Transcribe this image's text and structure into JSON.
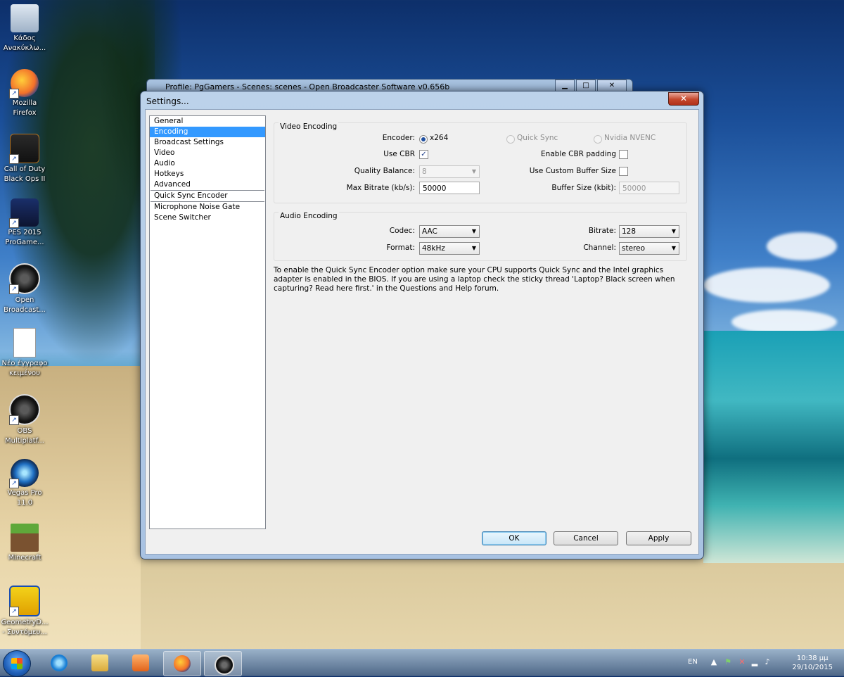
{
  "desktop": {
    "icons": [
      {
        "label": "Κάδος Ανακύκλω...",
        "icon": "recycle-bin-icon"
      },
      {
        "label": "Mozilla Firefox",
        "icon": "firefox-icon"
      },
      {
        "label": "Call of Duty Black Ops II",
        "icon": "game-icon"
      },
      {
        "label": "PES 2015 ProGame...",
        "icon": "game-icon"
      },
      {
        "label": "Open Broadcast...",
        "icon": "obs-icon"
      },
      {
        "label": "Νέο έγγραφο κειμένου",
        "icon": "text-file-icon"
      },
      {
        "label": "OBS Multiplatf...",
        "icon": "obs-icon"
      },
      {
        "label": "Vegas Pro 11.0",
        "icon": "vegas-icon"
      },
      {
        "label": "Minecraft",
        "icon": "minecraft-icon"
      },
      {
        "label": "GeometryD... - Συντόμευ...",
        "icon": "game-icon"
      }
    ]
  },
  "background_window": {
    "title": "Profile: PgGamers - Scenes: scenes - Open Broadcaster Software v0.656b",
    "min": "▁",
    "max": "□",
    "close": "✕"
  },
  "dialog": {
    "title": "Settings...",
    "close": "✕",
    "sidebar": {
      "items": [
        {
          "label": "General",
          "selected": false
        },
        {
          "label": "Encoding",
          "selected": true
        },
        {
          "label": "Broadcast Settings",
          "selected": false
        },
        {
          "label": "Video",
          "selected": false
        },
        {
          "label": "Audio",
          "selected": false
        },
        {
          "label": "Hotkeys",
          "selected": false
        },
        {
          "label": "Advanced",
          "selected": false
        },
        {
          "label": "Quick Sync Encoder",
          "selected": false
        },
        {
          "label": "Microphone Noise Gate",
          "selected": false
        },
        {
          "label": "Scene Switcher",
          "selected": false
        }
      ]
    },
    "video_encoding": {
      "title": "Video Encoding",
      "encoder_label": "Encoder:",
      "encoder_options": [
        "x264",
        "Quick Sync",
        "Nvidia NVENC"
      ],
      "encoder_selected": "x264",
      "use_cbr_label": "Use CBR",
      "use_cbr_checked": "✓",
      "enable_cbr_padding_label": "Enable CBR padding",
      "quality_balance_label": "Quality Balance:",
      "quality_balance_value": "8",
      "use_custom_buffer_label": "Use Custom Buffer Size",
      "max_bitrate_label": "Max Bitrate (kb/s):",
      "max_bitrate_value": "50000",
      "buffer_size_label": "Buffer Size (kbit):",
      "buffer_size_value": "50000"
    },
    "audio_encoding": {
      "title": "Audio Encoding",
      "codec_label": "Codec:",
      "codec_value": "AAC",
      "bitrate_label": "Bitrate:",
      "bitrate_value": "128",
      "format_label": "Format:",
      "format_value": "48kHz",
      "channel_label": "Channel:",
      "channel_value": "stereo"
    },
    "info_text": "To enable the Quick Sync Encoder option make sure your CPU supports Quick Sync and the Intel graphics adapter is enabled in the BIOS. If you are using a laptop check the sticky thread 'Laptop? Black screen when capturing? Read here first.' in the Questions and Help forum.",
    "buttons": {
      "ok": "OK",
      "cancel": "Cancel",
      "apply": "Apply"
    }
  },
  "taskbar": {
    "language": "EN",
    "time": "10:38 μμ",
    "date": "29/10/2015",
    "items": [
      "ie-icon",
      "explorer-icon",
      "media-player-icon",
      "firefox-icon",
      "obs-icon"
    ]
  }
}
